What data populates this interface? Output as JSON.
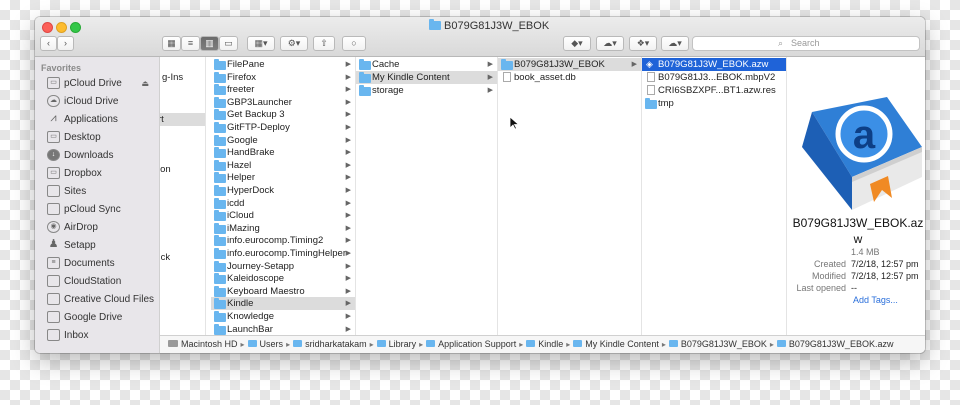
{
  "window": {
    "title": "B079G81J3W_EBOK"
  },
  "search": {
    "placeholder": "Search"
  },
  "sidebar": {
    "heading": "Favorites",
    "items": [
      {
        "label": "pCloud Drive",
        "icon": "drive-icon",
        "eject": "⏏"
      },
      {
        "label": "iCloud Drive",
        "icon": "cloud-icon"
      },
      {
        "label": "Applications",
        "icon": "applications-icon"
      },
      {
        "label": "Desktop",
        "icon": "desktop-icon"
      },
      {
        "label": "Downloads",
        "icon": "downloads-icon"
      },
      {
        "label": "Dropbox",
        "icon": "dropbox-icon"
      },
      {
        "label": "Sites",
        "icon": "folder-icon"
      },
      {
        "label": "pCloud Sync",
        "icon": "folder-icon"
      },
      {
        "label": "AirDrop",
        "icon": "airdrop-icon"
      },
      {
        "label": "Setapp",
        "icon": "setapp-icon"
      },
      {
        "label": "Documents",
        "icon": "documents-icon"
      },
      {
        "label": "CloudStation",
        "icon": "folder-icon"
      },
      {
        "label": "Creative Cloud Files",
        "icon": "folder-icon"
      },
      {
        "label": "Google Drive",
        "icon": "folder-icon"
      },
      {
        "label": "Inbox",
        "icon": "folder-icon"
      }
    ]
  },
  "col0": {
    "fragments": [
      "g-Ins",
      "rt",
      "ion",
      ".ck"
    ]
  },
  "col1": {
    "items": [
      "FilePane",
      "Firefox",
      "freeter",
      "GBP3Launcher",
      "Get Backup 3",
      "GitFTP-Deploy",
      "Google",
      "HandBrake",
      "Hazel",
      "Helper",
      "HyperDock",
      "icdd",
      "iCloud",
      "iMazing",
      "info.eurocomp.Timing2",
      "info.eurocomp.TimingHelper",
      "Journey-Setapp",
      "Kaleidoscope",
      "Keyboard Maestro",
      "Kindle",
      "Knowledge",
      "LaunchBar"
    ]
  },
  "col2": {
    "items": [
      "Cache",
      "My Kindle Content",
      "storage"
    ]
  },
  "col3": {
    "items": [
      "B079G81J3W_EBOK",
      "book_asset.db"
    ]
  },
  "col4": {
    "items": [
      "B079G81J3W_EBOK.azw",
      "B079G81J3...EBOK.mbpV2",
      "CRI6SBZXPF...BT1.azw.res",
      "tmp"
    ]
  },
  "preview": {
    "name": "B079G81J3W_EBOK.azw",
    "size": "1.4 MB",
    "created_label": "Created",
    "created": "7/2/18, 12:57 pm",
    "modified_label": "Modified",
    "modified": "7/2/18, 12:57 pm",
    "last_opened_label": "Last opened",
    "last_opened": "--",
    "add_tags": "Add Tags..."
  },
  "pathbar": [
    "Macintosh HD",
    "Users",
    "sridharkatakam",
    "Library",
    "Application Support",
    "Kindle",
    "My Kindle Content",
    "B079G81J3W_EBOK",
    "B079G81J3W_EBOK.azw"
  ],
  "colors": {
    "selection": "#1f63d8",
    "folder": "#69b6ef",
    "accent_link": "#2a6fdb"
  }
}
